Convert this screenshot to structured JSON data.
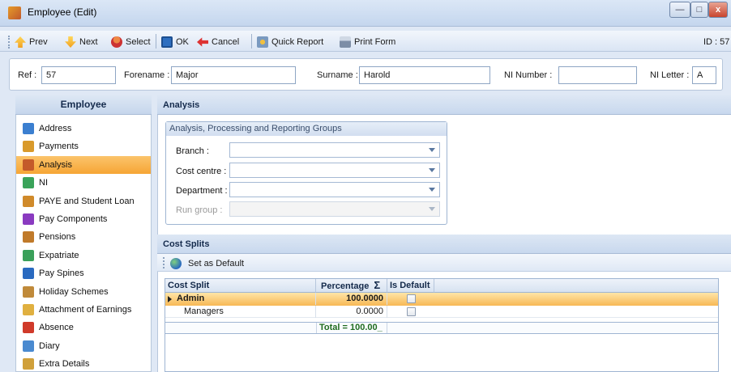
{
  "window": {
    "title": "Employee (Edit)"
  },
  "toolbar": {
    "prev": "Prev",
    "next": "Next",
    "select": "Select",
    "ok": "OK",
    "cancel": "Cancel",
    "quick_report": "Quick Report",
    "print_form": "Print Form",
    "id_label": "ID : 57"
  },
  "header": {
    "ref_label": "Ref :",
    "ref_value": "57",
    "forename_label": "Forename :",
    "forename_value": "Major",
    "surname_label": "Surname :",
    "surname_value": "Harold",
    "ni_number_label": "NI Number :",
    "ni_number_value": "",
    "ni_letter_label": "NI Letter :",
    "ni_letter_value": "A"
  },
  "nav": {
    "title": "Employee",
    "items": [
      {
        "label": "Address",
        "icon": "people-icon",
        "color": "#3b7fd0"
      },
      {
        "label": "Payments",
        "icon": "wallet-icon",
        "color": "#d99a2b"
      },
      {
        "label": "Analysis",
        "icon": "org-chart-icon",
        "color": "#c45a2a"
      },
      {
        "label": "NI",
        "icon": "ni-icon",
        "color": "#3aa35a"
      },
      {
        "label": "PAYE and Student Loan",
        "icon": "paye-icon",
        "color": "#d08a2a"
      },
      {
        "label": "Pay Components",
        "icon": "components-icon",
        "color": "#8a3ac0"
      },
      {
        "label": "Pensions",
        "icon": "pensions-icon",
        "color": "#c07a2a"
      },
      {
        "label": "Expatriate",
        "icon": "globe-icon",
        "color": "#3aa05a"
      },
      {
        "label": "Pay Spines",
        "icon": "spines-icon",
        "color": "#2a6ac0"
      },
      {
        "label": "Holiday Schemes",
        "icon": "holiday-icon",
        "color": "#c08a3a"
      },
      {
        "label": "Attachment of Earnings",
        "icon": "attachment-icon",
        "color": "#e0b040"
      },
      {
        "label": "Absence",
        "icon": "absence-icon",
        "color": "#d03a2a"
      },
      {
        "label": "Diary",
        "icon": "diary-icon",
        "color": "#4a8ad0"
      },
      {
        "label": "Extra Details",
        "icon": "extra-icon",
        "color": "#d0a03a"
      }
    ],
    "selected": "Analysis"
  },
  "analysis": {
    "section_title": "Analysis",
    "group_title": "Analysis, Processing and Reporting Groups",
    "fields": [
      {
        "label": "Branch :",
        "value": ""
      },
      {
        "label": "Cost centre :",
        "value": ""
      },
      {
        "label": "Department :",
        "value": ""
      },
      {
        "label": "Run group :",
        "value": ""
      }
    ]
  },
  "cost_splits": {
    "section_title": "Cost Splits",
    "set_default": "Set as Default",
    "columns": {
      "cost_split": "Cost Split",
      "percentage": "Percentage",
      "sigma": "Σ",
      "is_default": "Is Default"
    },
    "rows": [
      {
        "cost_split": "Admin",
        "percentage": "100.0000",
        "is_default": false
      },
      {
        "cost_split": "Managers",
        "percentage": "0.0000",
        "is_default": false
      }
    ],
    "total": "Total = 100.00_"
  }
}
